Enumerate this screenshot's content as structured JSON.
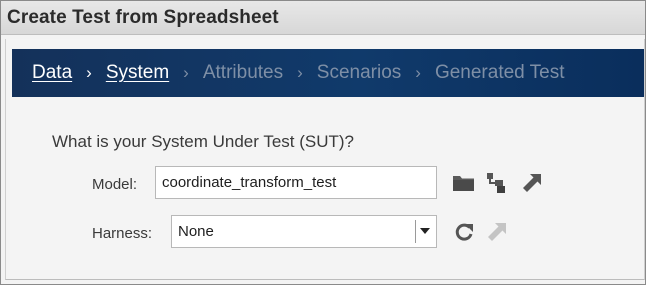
{
  "window": {
    "title": "Create Test from Spreadsheet"
  },
  "wizard": {
    "steps": [
      {
        "label": "Data",
        "state": "completed"
      },
      {
        "label": "System",
        "state": "current"
      },
      {
        "label": "Attributes",
        "state": "pending"
      },
      {
        "label": "Scenarios",
        "state": "pending"
      },
      {
        "label": "Generated Test",
        "state": "pending"
      }
    ],
    "separator": "›"
  },
  "sut": {
    "question": "What is your System Under Test (SUT)?",
    "model_label": "Model:",
    "model_value": "coordinate_transform_test",
    "harness_label": "Harness:",
    "harness_value": "None"
  },
  "icons": {
    "open_model": "folder-icon",
    "new_model": "new-model-icon",
    "goto_model": "go-to-arrow-icon",
    "refresh_harness": "refresh-icon",
    "goto_harness": "go-to-arrow-icon"
  },
  "colors": {
    "nav_background": "#103a6b",
    "nav_active_text": "#ffffff",
    "nav_inactive_text": "#7e8fa6",
    "icon_enabled": "#555555",
    "icon_disabled": "#c4c4c4"
  }
}
